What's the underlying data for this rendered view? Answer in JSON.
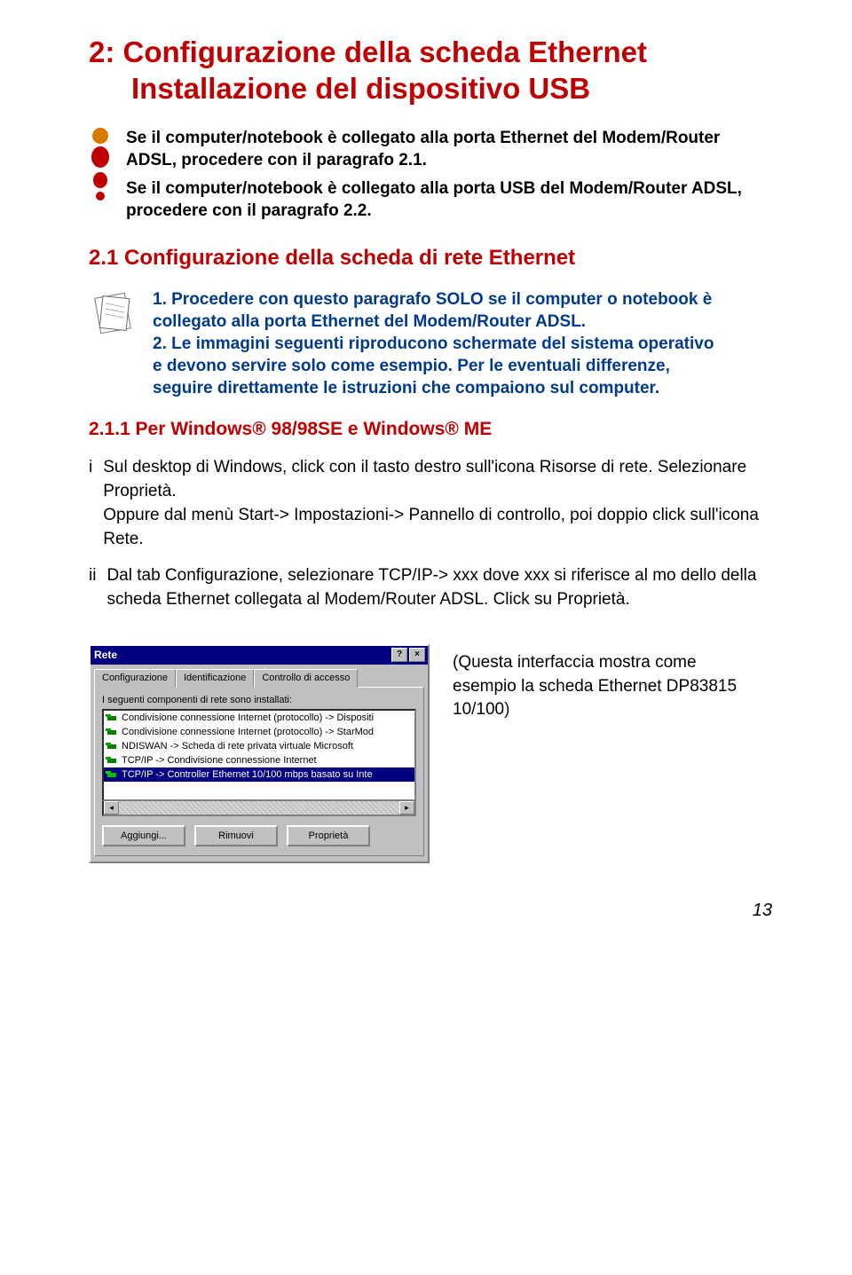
{
  "heading": {
    "line1": "2: Configurazione della scheda Ethernet",
    "line2": "Installazione del dispositivo USB"
  },
  "intro": {
    "p1": "Se il computer/notebook è collegato alla porta Ethernet del Modem/Router ADSL, procedere con il paragrafo 2.1.",
    "p2": "Se il computer/notebook è collegato alla porta USB del Modem/Router ADSL, procedere con il paragrafo 2.2."
  },
  "section21_title": "2.1 Configurazione della scheda di rete Ethernet",
  "note": "1. Procedere con questo paragrafo SOLO se il computer o notebook è collegato alla porta Ethernet del Modem/Router ADSL.\n2. Le immagini seguenti riproducono schermate del sistema operativo e devono servire solo come esempio. Per le eventuali differenze, seguire direttamente le istruzioni che compaiono sul computer.",
  "section211_title": "2.1.1 Per Windows® 98/98SE e Windows® ME",
  "steps": [
    {
      "num": "i",
      "text": "Sul desktop di Windows, click con il tasto destro sull'icona Risorse di rete. Selezionare Proprietà.\nOppure dal menù Start-> Impostazioni-> Pannello di controllo, poi doppio click sull'icona Rete."
    },
    {
      "num": "ii",
      "text": "Dal tab Configurazione, selezionare TCP/IP-> xxx dove xxx si riferisce al mo dello della scheda Ethernet collegata al Modem/Router ADSL. Click su Proprietà."
    }
  ],
  "dialog": {
    "title": "Rete",
    "tabs": [
      "Configurazione",
      "Identificazione",
      "Controllo di accesso"
    ],
    "list_label": "I seguenti componenti di rete sono installati:",
    "items": [
      "Condivisione connessione Internet (protocollo) -> Dispositi",
      "Condivisione connessione Internet (protocollo) -> StarMod",
      "NDISWAN -> Scheda di rete privata virtuale Microsoft",
      "TCP/IP -> Condivisione connessione Internet",
      "TCP/IP -> Controller Ethernet 10/100 mbps basato su Inte"
    ],
    "selected_index": 4,
    "buttons": {
      "add": "Aggiungi...",
      "remove": "Rimuovi",
      "props": "Proprietà"
    }
  },
  "caption": "(Questa interfaccia mostra come esempio la scheda Ethernet DP83815 10/100)",
  "page_number": "13"
}
